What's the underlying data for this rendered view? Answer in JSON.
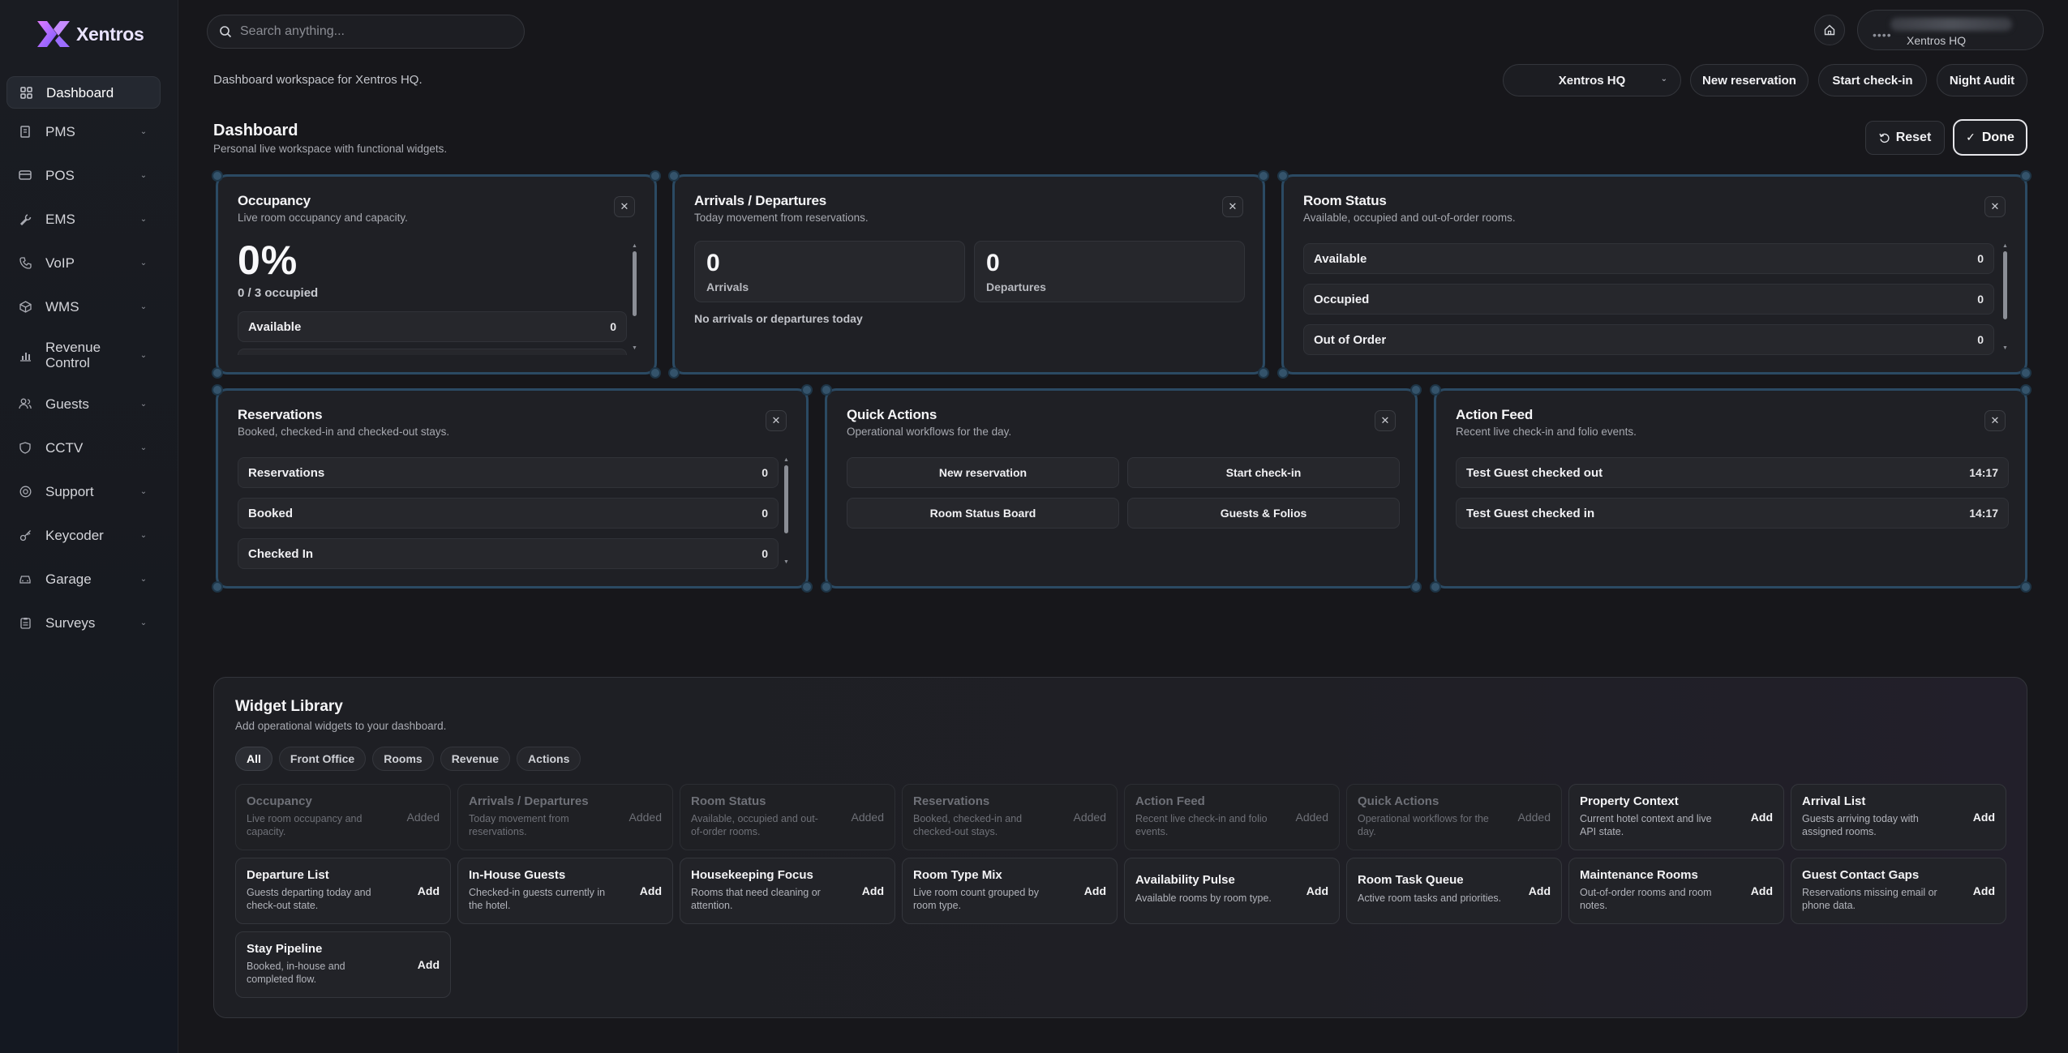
{
  "app": {
    "name": "Xentros"
  },
  "search": {
    "placeholder": "Search anything..."
  },
  "user": {
    "property": "Xentros HQ",
    "avatar_icon": "more-dots-icon"
  },
  "sidebar": {
    "items": [
      {
        "label": "Dashboard",
        "icon": "dashboard-icon",
        "active": true
      },
      {
        "label": "PMS",
        "icon": "building-icon"
      },
      {
        "label": "POS",
        "icon": "credit-card-icon"
      },
      {
        "label": "EMS",
        "icon": "wrench-icon"
      },
      {
        "label": "VoIP",
        "icon": "phone-icon"
      },
      {
        "label": "WMS",
        "icon": "box-icon"
      },
      {
        "label": "Revenue Control",
        "icon": "bar-chart-icon"
      },
      {
        "label": "Guests",
        "icon": "users-icon"
      },
      {
        "label": "CCTV",
        "icon": "shield-icon"
      },
      {
        "label": "Support",
        "icon": "lifebuoy-icon"
      },
      {
        "label": "Keycoder",
        "icon": "key-icon"
      },
      {
        "label": "Garage",
        "icon": "car-icon"
      },
      {
        "label": "Surveys",
        "icon": "clipboard-icon"
      }
    ]
  },
  "header": {
    "workspace_text": "Dashboard workspace for Xentros HQ.",
    "property_select": "Xentros HQ",
    "new_reservation": "New reservation",
    "start_checkin": "Start check-in",
    "night_audit": "Night Audit",
    "title": "Dashboard",
    "subtitle": "Personal live workspace with functional widgets.",
    "reset": "Reset",
    "done": "Done"
  },
  "widgets": {
    "occupancy": {
      "title": "Occupancy",
      "subtitle": "Live room occupancy and capacity.",
      "percent": "0%",
      "occupied": "0 / 3 occupied",
      "rows": [
        {
          "label": "Available",
          "value": "0"
        }
      ]
    },
    "arrivals": {
      "title": "Arrivals / Departures",
      "subtitle": "Today movement from reservations.",
      "arrivals_value": "0",
      "arrivals_label": "Arrivals",
      "departures_value": "0",
      "departures_label": "Departures",
      "note": "No arrivals or departures today"
    },
    "room_status": {
      "title": "Room Status",
      "subtitle": "Available, occupied and out-of-order rooms.",
      "rows": [
        {
          "label": "Available",
          "value": "0"
        },
        {
          "label": "Occupied",
          "value": "0"
        },
        {
          "label": "Out of Order",
          "value": "0"
        }
      ]
    },
    "reservations": {
      "title": "Reservations",
      "subtitle": "Booked, checked-in and checked-out stays.",
      "rows": [
        {
          "label": "Reservations",
          "value": "0"
        },
        {
          "label": "Booked",
          "value": "0"
        },
        {
          "label": "Checked In",
          "value": "0"
        }
      ]
    },
    "quick_actions": {
      "title": "Quick Actions",
      "subtitle": "Operational workflows for the day.",
      "buttons": [
        "New reservation",
        "Start check-in",
        "Room Status Board",
        "Guests & Folios"
      ]
    },
    "action_feed": {
      "title": "Action Feed",
      "subtitle": "Recent live check-in and folio events.",
      "rows": [
        {
          "label": "Test Guest checked out",
          "time": "14:17"
        },
        {
          "label": "Test Guest checked in",
          "time": "14:17"
        }
      ]
    }
  },
  "library": {
    "title": "Widget Library",
    "subtitle": "Add operational widgets to your dashboard.",
    "filters": [
      "All",
      "Front Office",
      "Rooms",
      "Revenue",
      "Actions"
    ],
    "active_filter": "All",
    "cards": [
      {
        "name": "Occupancy",
        "desc": "Live room occupancy and capacity.",
        "action": "Added",
        "added": true
      },
      {
        "name": "Arrivals / Departures",
        "desc": "Today movement from reservations.",
        "action": "Added",
        "added": true
      },
      {
        "name": "Room Status",
        "desc": "Available, occupied and out-of-order rooms.",
        "action": "Added",
        "added": true
      },
      {
        "name": "Reservations",
        "desc": "Booked, checked-in and checked-out stays.",
        "action": "Added",
        "added": true
      },
      {
        "name": "Action Feed",
        "desc": "Recent live check-in and folio events.",
        "action": "Added",
        "added": true
      },
      {
        "name": "Quick Actions",
        "desc": "Operational workflows for the day.",
        "action": "Added",
        "added": true
      },
      {
        "name": "Property Context",
        "desc": "Current hotel context and live API state.",
        "action": "Add",
        "added": false
      },
      {
        "name": "Arrival List",
        "desc": "Guests arriving today with assigned rooms.",
        "action": "Add",
        "added": false
      },
      {
        "name": "Departure List",
        "desc": "Guests departing today and check-out state.",
        "action": "Add",
        "added": false
      },
      {
        "name": "In-House Guests",
        "desc": "Checked-in guests currently in the hotel.",
        "action": "Add",
        "added": false
      },
      {
        "name": "Housekeeping Focus",
        "desc": "Rooms that need cleaning or attention.",
        "action": "Add",
        "added": false
      },
      {
        "name": "Room Type Mix",
        "desc": "Live room count grouped by room type.",
        "action": "Add",
        "added": false
      },
      {
        "name": "Availability Pulse",
        "desc": "Available rooms by room type.",
        "action": "Add",
        "added": false
      },
      {
        "name": "Room Task Queue",
        "desc": "Active room tasks and priorities.",
        "action": "Add",
        "added": false
      },
      {
        "name": "Maintenance Rooms",
        "desc": "Out-of-order rooms and room notes.",
        "action": "Add",
        "added": false
      },
      {
        "name": "Guest Contact Gaps",
        "desc": "Reservations missing email or phone data.",
        "action": "Add",
        "added": false
      },
      {
        "name": "Stay Pipeline",
        "desc": "Booked, in-house and completed flow.",
        "action": "Add",
        "added": false
      }
    ]
  },
  "colors": {
    "widget_border": "#2b4a63",
    "accent_logo": "#b86cff"
  }
}
